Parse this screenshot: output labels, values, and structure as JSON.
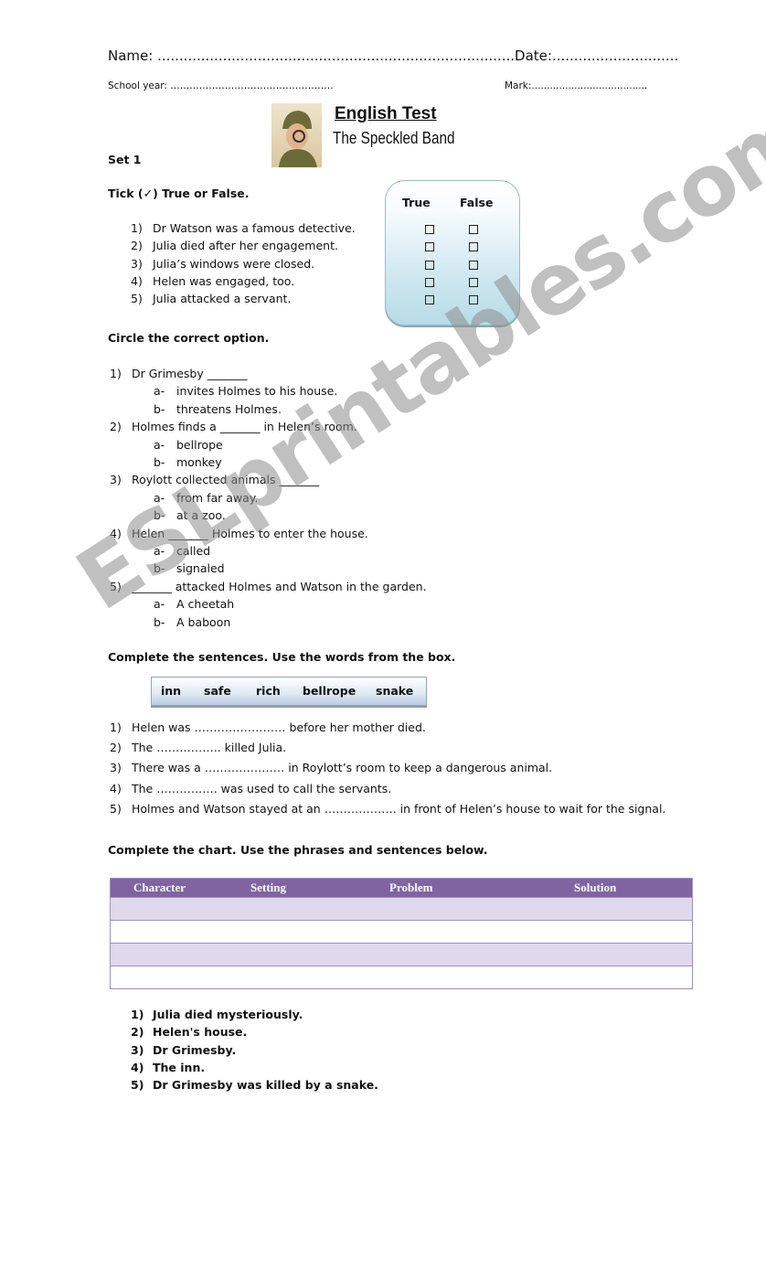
{
  "header": {
    "name_line": "Name: ..................................................................................Date:.............................",
    "school_year_line": "School year: ……………………………………………",
    "mark_line": "Mark:......................................",
    "title": "English Test",
    "subtitle": "The Speckled Band",
    "set": "Set 1"
  },
  "true_false": {
    "heading": "Tick (✓) True or False.",
    "col_true": "True",
    "col_false": "False",
    "items": [
      {
        "num": "1)",
        "text": "Dr Watson was a famous detective."
      },
      {
        "num": "2)",
        "text": "Julia died after her engagement."
      },
      {
        "num": "3)",
        "text": "Julia’s windows were closed."
      },
      {
        "num": "4)",
        "text": "Helen was engaged, too."
      },
      {
        "num": "5)",
        "text": "Julia attacked a servant."
      }
    ]
  },
  "circle": {
    "heading": "Circle the correct option.",
    "questions": [
      {
        "num": "1)",
        "text": "Dr Grimesby _______",
        "options": [
          {
            "l": "a-",
            "t": "invites Holmes to his house."
          },
          {
            "l": "b-",
            "t": "threatens Holmes."
          }
        ]
      },
      {
        "num": "2)",
        "text": "Holmes finds a _______ in Helen’s room.",
        "options": [
          {
            "l": "a-",
            "t": "bellrope"
          },
          {
            "l": "b-",
            "t": "monkey"
          }
        ]
      },
      {
        "num": "3)",
        "text": "Roylott collected animals _______",
        "options": [
          {
            "l": "a-",
            "t": "from far away."
          },
          {
            "l": "b-",
            "t": "at a zoo."
          }
        ]
      },
      {
        "num": "4)",
        "text": "Helen _______ Holmes to enter the house.",
        "options": [
          {
            "l": "a-",
            "t": "called"
          },
          {
            "l": "b-",
            "t": "signaled"
          }
        ]
      },
      {
        "num": "5)",
        "text": "_______ attacked Holmes and Watson in the garden.",
        "options": [
          {
            "l": "a-",
            "t": "A cheetah"
          },
          {
            "l": "b-",
            "t": "A baboon"
          }
        ]
      }
    ]
  },
  "complete": {
    "heading": "Complete the sentences. Use the words from the box.",
    "words": [
      "inn",
      "safe",
      "rich",
      "bellrope",
      "snake"
    ],
    "sentences": [
      {
        "num": "1)",
        "text": "Helen was …………………… before her mother died."
      },
      {
        "num": "2)",
        "text": "The …………….. killed Julia."
      },
      {
        "num": "3)",
        "text": "There was a ………………… in Roylott’s room to keep a dangerous animal."
      },
      {
        "num": "4)",
        "text": "The ……………. was used to call the servants."
      },
      {
        "num": "5)",
        "text": "Holmes and Watson stayed at an ………………. in front of Helen’s house to wait for the signal."
      }
    ]
  },
  "chart": {
    "heading": "Complete the chart. Use the phrases and sentences below.",
    "columns": [
      "Character",
      "Setting",
      "Problem",
      "Solution"
    ],
    "phrases": [
      {
        "num": "1)",
        "text": "Julia died mysteriously."
      },
      {
        "num": "2)",
        "text": "Helen's house."
      },
      {
        "num": "3)",
        "text": "Dr Grimesby."
      },
      {
        "num": "4)",
        "text": "The inn."
      },
      {
        "num": "5)",
        "text": "Dr Grimesby was killed by a snake."
      }
    ]
  },
  "watermark": "ESLprintables.com",
  "colors": {
    "table_header": "#8064a2",
    "table_alt_row": "#e0d8ec",
    "tf_box": "#b7dbe7"
  }
}
